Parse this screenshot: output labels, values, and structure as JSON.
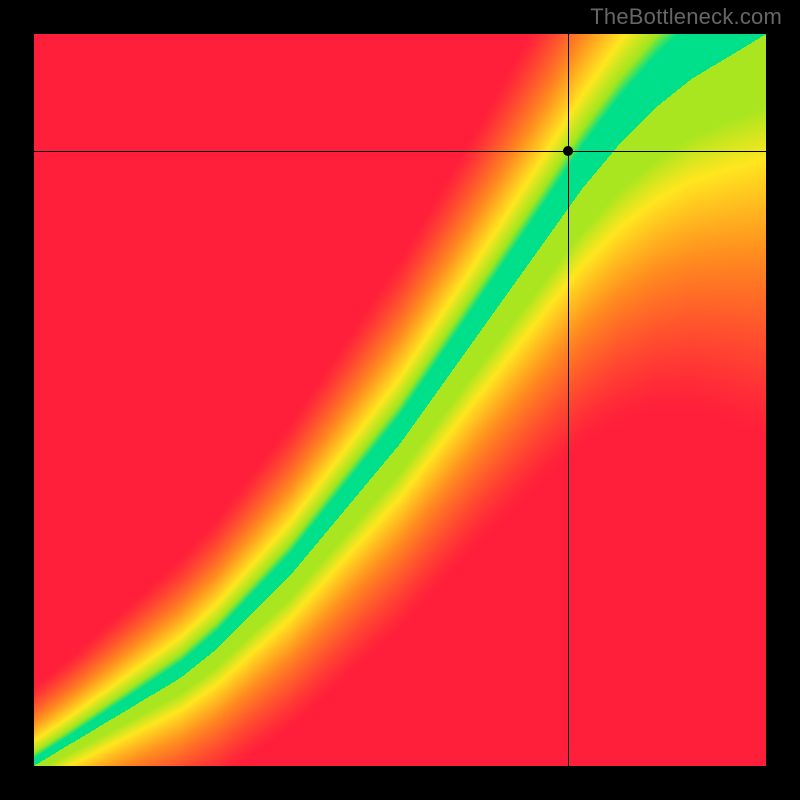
{
  "attribution": "TheBottleneck.com",
  "chart_data": {
    "type": "heatmap",
    "title": "",
    "xlabel": "",
    "ylabel": "",
    "xlim": [
      0,
      100
    ],
    "ylim": [
      0,
      100
    ],
    "colorscale": [
      {
        "stop": 0.0,
        "color": "#ff1f3a",
        "meaning": "severe bottleneck"
      },
      {
        "stop": 0.4,
        "color": "#ff8a1f",
        "meaning": "moderate bottleneck"
      },
      {
        "stop": 0.7,
        "color": "#ffe61f",
        "meaning": "mild bottleneck"
      },
      {
        "stop": 0.9,
        "color": "#9fe61f",
        "meaning": "near balance"
      },
      {
        "stop": 1.0,
        "color": "#00e08a",
        "meaning": "balanced"
      }
    ],
    "optimal_curve": {
      "description": "ideal GPU/CPU balance ridge (y as function of x, normalized 0-100). Green band ~ ±6 around this ridge; band widens toward upper right.",
      "x": [
        0,
        5,
        10,
        15,
        20,
        25,
        30,
        35,
        40,
        45,
        50,
        55,
        60,
        65,
        70,
        75,
        80,
        85,
        90,
        95,
        100
      ],
      "y_mid": [
        0,
        3,
        6,
        9,
        12,
        16,
        21,
        26,
        32,
        38,
        44,
        51,
        58,
        65,
        72,
        79,
        85,
        90,
        94,
        97,
        100
      ],
      "half_width": [
        1,
        1.2,
        1.5,
        1.8,
        2.1,
        2.4,
        2.7,
        3.0,
        3.3,
        3.6,
        3.9,
        4.2,
        4.5,
        4.9,
        5.3,
        5.8,
        6.4,
        7.1,
        7.9,
        8.8,
        9.8
      ]
    },
    "crosshair": {
      "x": 73,
      "y": 84
    },
    "marker": {
      "x": 73,
      "y": 84
    },
    "grid": false,
    "legend": false
  }
}
